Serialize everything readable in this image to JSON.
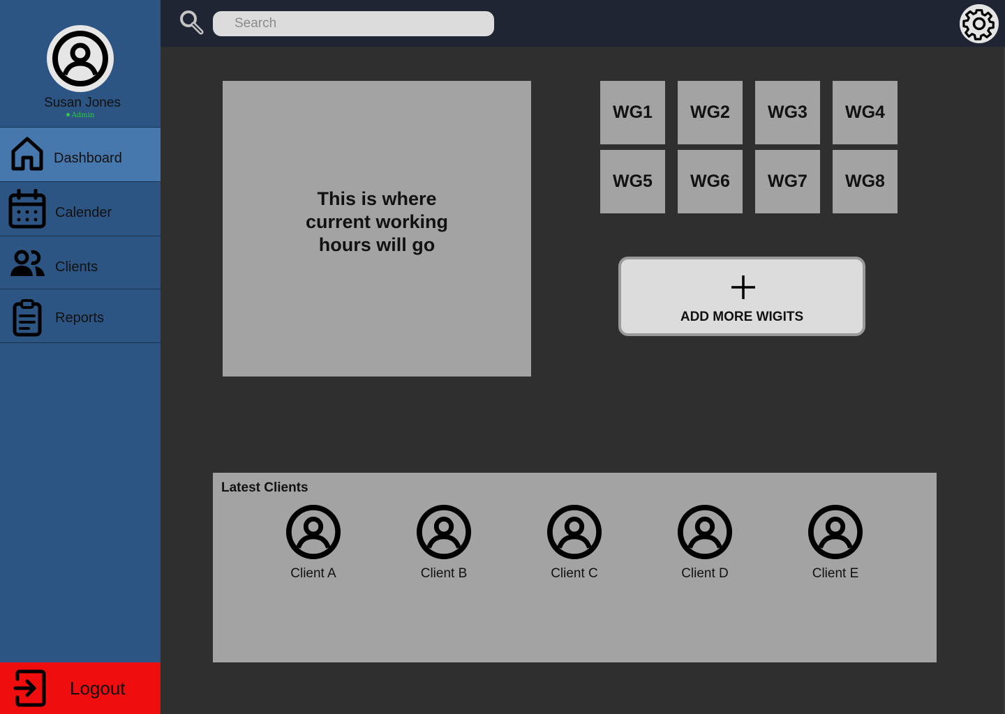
{
  "user": {
    "name": "Susan Jones",
    "role": "Admin"
  },
  "nav": {
    "items": [
      {
        "label": "Dashboard",
        "icon": "home-icon",
        "active": true
      },
      {
        "label": "Calender",
        "icon": "calendar-icon",
        "active": false
      },
      {
        "label": "Clients",
        "icon": "users-icon",
        "active": false
      },
      {
        "label": "Reports",
        "icon": "clipboard-icon",
        "active": false
      }
    ],
    "logout_label": "Logout"
  },
  "search": {
    "placeholder": "Search",
    "value": ""
  },
  "hours_panel": {
    "text": "This is where current working hours will go"
  },
  "widgets": [
    "WG1",
    "WG2",
    "WG3",
    "WG4",
    "WG5",
    "WG6",
    "WG7",
    "WG8"
  ],
  "add_widget": {
    "label": "ADD MORE WIGITS"
  },
  "latest_clients": {
    "title": "Latest Clients",
    "clients": [
      "Client A",
      "Client B",
      "Client C",
      "Client D",
      "Client E"
    ]
  },
  "colors": {
    "sidebar": "#2c5583",
    "sidebar_active": "#4678ad",
    "topbar": "#1f2533",
    "background": "#2f2f2f",
    "panel": "#a3a3a3",
    "logout": "#f00d0d",
    "status": "#2ecc40"
  }
}
